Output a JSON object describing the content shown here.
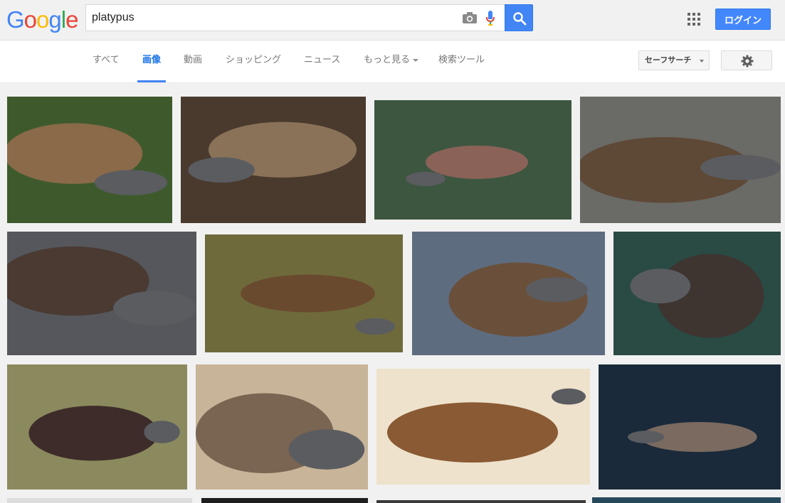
{
  "logo": {
    "letters": [
      "G",
      "o",
      "o",
      "g",
      "l",
      "e"
    ]
  },
  "search": {
    "query": "platypus"
  },
  "header": {
    "login_label": "ログイン"
  },
  "tabs": [
    {
      "label": "すべて"
    },
    {
      "label": "画像",
      "active": true
    },
    {
      "label": "動画"
    },
    {
      "label": "ショッピング"
    },
    {
      "label": "ニュース"
    },
    {
      "label": "もっと見る"
    },
    {
      "label": "検索ツール"
    }
  ],
  "safesearch": {
    "label": "セーフサーチ"
  },
  "icons": {
    "camera": "camera-icon",
    "mic": "mic-icon",
    "search": "search-icon",
    "apps": "apps-grid-icon",
    "settings": "gear-icon"
  },
  "colors": {
    "accent": "#4285f4",
    "logo": [
      "#4285f4",
      "#ea4335",
      "#fbbc05",
      "#4285f4",
      "#34a853",
      "#ea4335"
    ]
  },
  "results": [
    {
      "bg": "#3e5a2c",
      "body": "#8a6a48"
    },
    {
      "bg": "#4a3a2e",
      "body": "#8a7258"
    },
    {
      "bg": "#3c5640",
      "body": "#8a6258"
    },
    {
      "bg": "#6a6a66",
      "body": "#5e4836"
    },
    {
      "bg": "#55575c",
      "body": "#4a3a32"
    },
    {
      "bg": "#6e6a3c",
      "body": "#6a4a2e"
    },
    {
      "bg": "#5e6c80",
      "body": "#6a503a"
    },
    {
      "bg": "#2a4a44",
      "body": "#3e3430"
    },
    {
      "bg": "#8a8a5e",
      "body": "#3e2c2a"
    },
    {
      "bg": "#c8b498",
      "body": "#7a6452"
    },
    {
      "bg": "#eee2cc",
      "body": "#8a5a34"
    },
    {
      "bg": "#1a2a3a",
      "body": "#7a6a60"
    },
    {
      "bg": "#dddddd",
      "body": "#cccccc"
    },
    {
      "bg": "#1e1e1e",
      "body": "#333333"
    },
    {
      "bg": "#3a3a3a",
      "body": "#555555"
    },
    {
      "bg": "#25495a",
      "body": "#3a5a6a"
    }
  ]
}
